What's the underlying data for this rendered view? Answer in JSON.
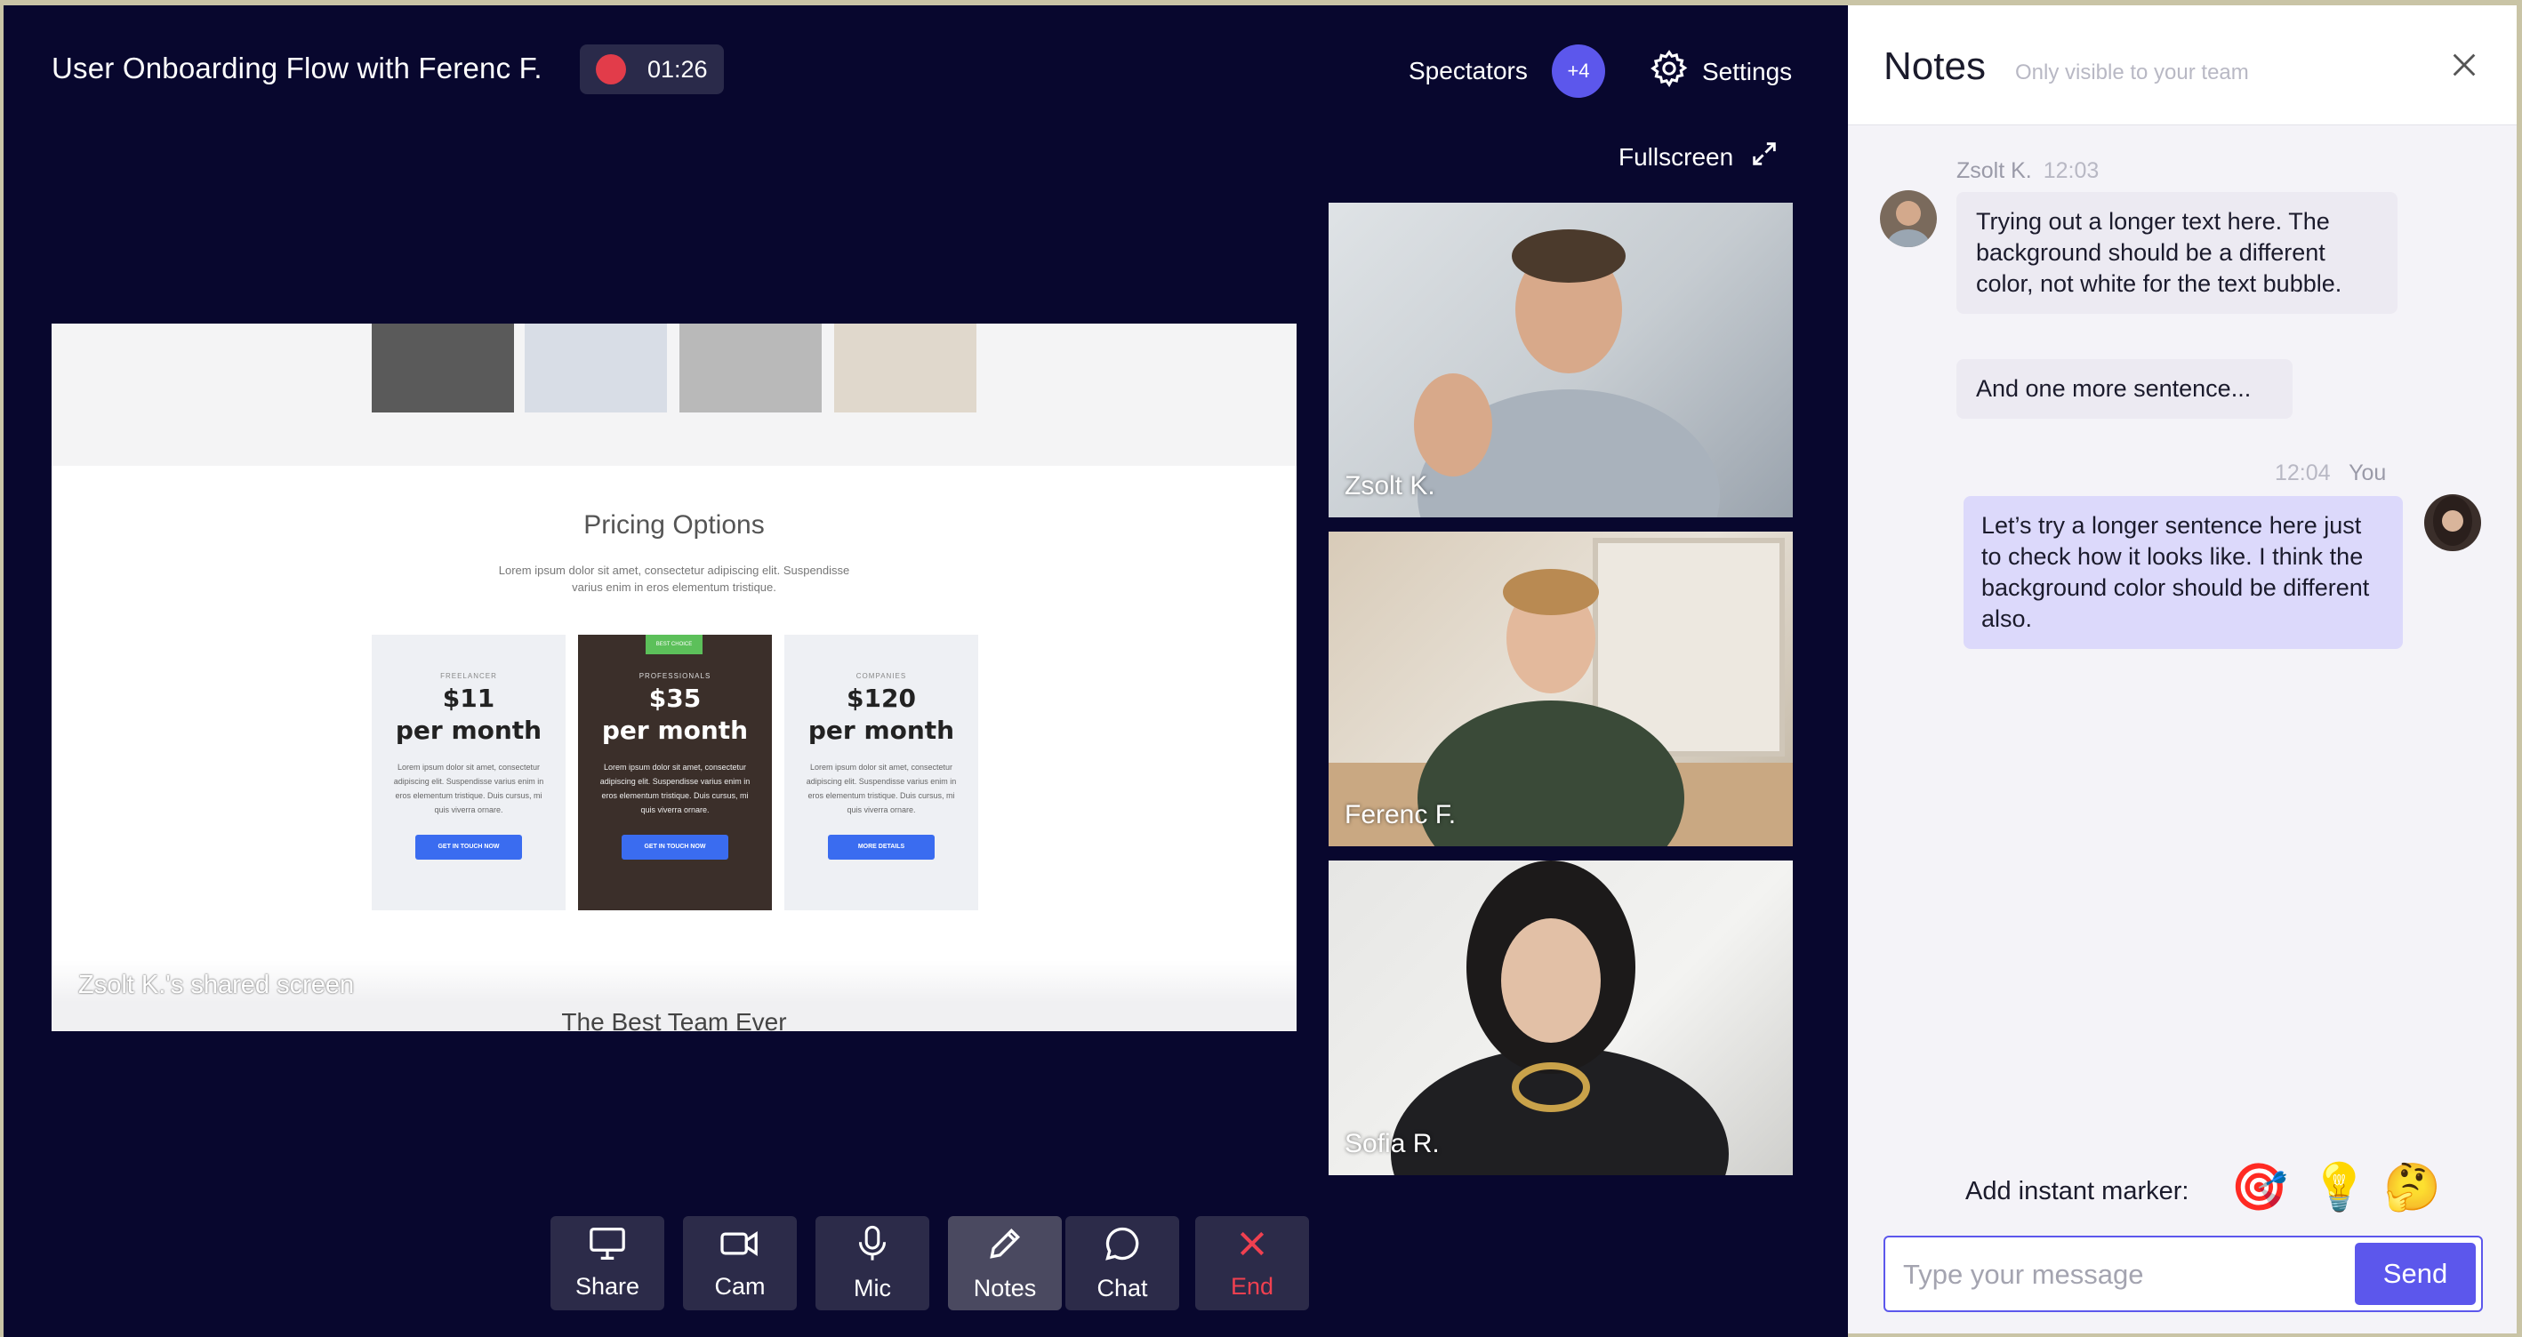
{
  "header": {
    "title": "User Onboarding Flow with Ferenc F.",
    "recording_time": "01:26",
    "spectators_label": "Spectators",
    "spectators_count": "+4",
    "settings_label": "Settings",
    "fullscreen_label": "Fullscreen"
  },
  "shared_screen": {
    "caption": "Zsolt K.'s shared screen",
    "page_title": "Pricing Options",
    "page_subtitle": "Lorem ipsum dolor sit amet, consectetur adipiscing elit. Suspendisse varius enim in eros elementum tristique.",
    "footer_heading": "The Best Team Ever",
    "plans": [
      {
        "tier": "FREELANCER",
        "price": "$11",
        "period": "per month",
        "desc": "Lorem ipsum dolor sit amet, consectetur adipiscing elit. Suspendisse varius enim in eros elementum tristique. Duis cursus, mi quis viverra ornare.",
        "cta": "GET IN TOUCH NOW",
        "badge": ""
      },
      {
        "tier": "PROFESSIONALS",
        "price": "$35",
        "period": "per month",
        "desc": "Lorem ipsum dolor sit amet, consectetur adipiscing elit. Suspendisse varius enim in eros elementum tristique. Duis cursus, mi quis viverra ornare.",
        "cta": "GET IN TOUCH NOW",
        "badge": "BEST CHOICE"
      },
      {
        "tier": "COMPANIES",
        "price": "$120",
        "period": "per month",
        "desc": "Lorem ipsum dolor sit amet, consectetur adipiscing elit. Suspendisse varius enim in eros elementum tristique. Duis cursus, mi quis viverra ornare.",
        "cta": "MORE DETAILS",
        "badge": ""
      }
    ]
  },
  "participants": [
    {
      "name": "Zsolt K."
    },
    {
      "name": "Ferenc F."
    },
    {
      "name": "Sofia R."
    }
  ],
  "toolbar": {
    "share": "Share",
    "cam": "Cam",
    "mic": "Mic",
    "notes": "Notes",
    "chat": "Chat",
    "end": "End"
  },
  "notes": {
    "title": "Notes",
    "subtitle": "Only visible to your team",
    "messages": [
      {
        "author": "Zsolt K.",
        "time": "12:03",
        "text": "Trying out a longer text here. The background should be a different color, not white for the text bubble."
      },
      {
        "author": "Zsolt K.",
        "time": "",
        "text": "And one more sentence..."
      },
      {
        "author": "You",
        "time": "12:04",
        "text": "Let’s try a longer sentence here just to check how it looks like. I think the background color should be different also."
      }
    ],
    "marker_label": "Add instant marker:",
    "markers": [
      "🎯",
      "💡",
      "🤔"
    ],
    "input_placeholder": "Type your message",
    "send_label": "Send"
  },
  "colors": {
    "background": "#08072e",
    "accent": "#5c57ec",
    "record": "#e23c4a",
    "end": "#f04050",
    "outgoing_bubble": "#dcd9fb",
    "incoming_bubble": "#eceaf2"
  }
}
